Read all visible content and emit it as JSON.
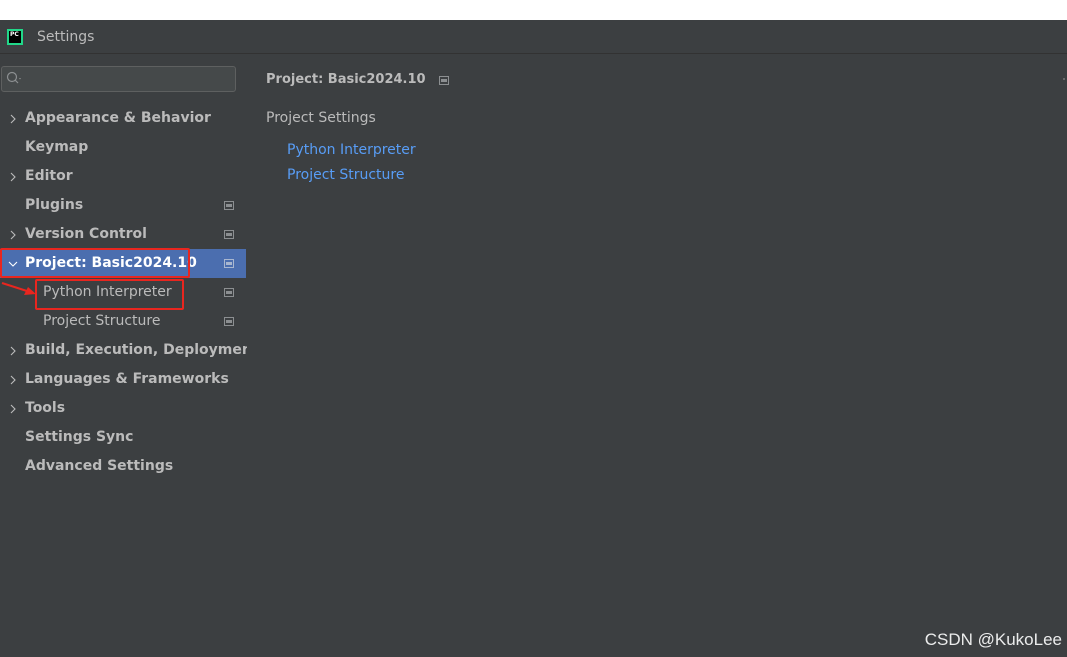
{
  "window": {
    "title": "Settings",
    "app_icon_text": "PC"
  },
  "search": {
    "value": "",
    "placeholder": ""
  },
  "tree": {
    "appearance": "Appearance & Behavior",
    "keymap": "Keymap",
    "editor": "Editor",
    "plugins": "Plugins",
    "version_control": "Version Control",
    "project": "Project: Basic2024.10",
    "python_interpreter": "Python Interpreter",
    "project_structure": "Project Structure",
    "build": "Build, Execution, Deployment",
    "languages": "Languages & Frameworks",
    "tools": "Tools",
    "settings_sync": "Settings Sync",
    "advanced": "Advanced Settings"
  },
  "content": {
    "breadcrumb": "Project: Basic2024.10",
    "section_title": "Project Settings",
    "links": [
      "Python Interpreter",
      "Project Structure"
    ]
  },
  "watermark": "CSDN @KukoLee",
  "colors": {
    "background": "#3c3f41",
    "selection": "#4b6eaf",
    "link": "#589df6",
    "highlight": "#e8261f"
  }
}
